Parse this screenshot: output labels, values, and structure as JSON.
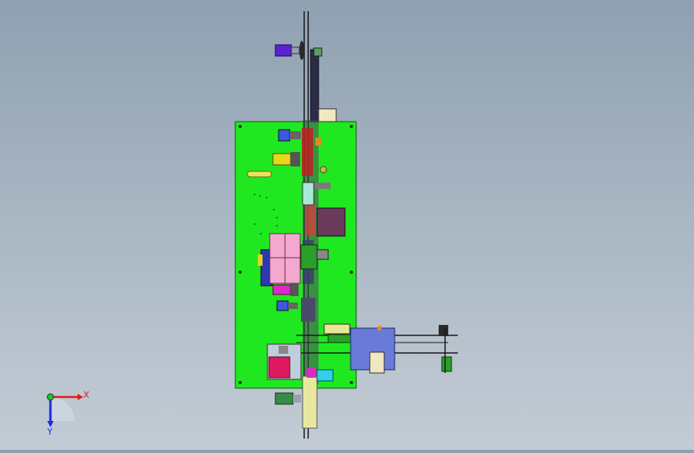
{
  "viewport": {
    "background_top": "#8fa0b1",
    "background_bottom": "#c3ccd5"
  },
  "triad": {
    "x_label": "X",
    "y_label": "Y",
    "x_color": "#e01c1c",
    "y_color": "#1c2ce0",
    "origin_color": "#22c02a"
  },
  "model": {
    "plate_color": "#1fe81f",
    "shaft_color": "#1a1a1a",
    "motor_colors": [
      "#5a1fd6",
      "#e0d21a",
      "#e028c8",
      "#3a5ae0",
      "#2f8a3c",
      "#e01a78"
    ]
  }
}
